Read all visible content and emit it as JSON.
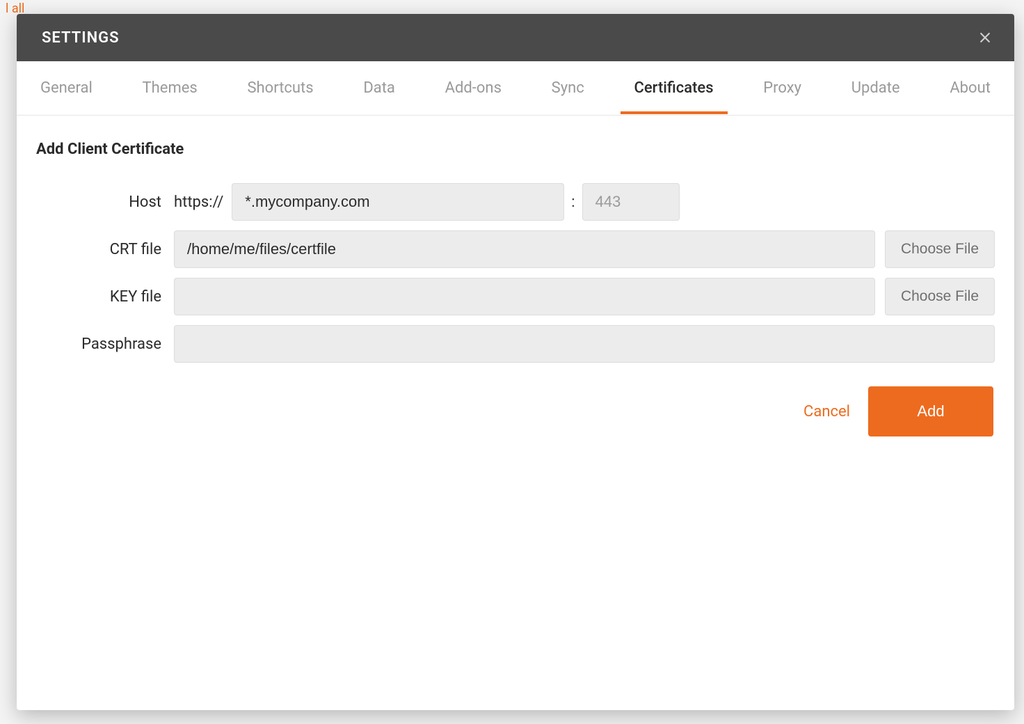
{
  "background": {
    "top_text": "l all"
  },
  "modal": {
    "title": "SETTINGS"
  },
  "tabs": {
    "items": [
      {
        "label": "General"
      },
      {
        "label": "Themes"
      },
      {
        "label": "Shortcuts"
      },
      {
        "label": "Data"
      },
      {
        "label": "Add-ons"
      },
      {
        "label": "Sync"
      },
      {
        "label": "Certificates"
      },
      {
        "label": "Proxy"
      },
      {
        "label": "Update"
      },
      {
        "label": "About"
      }
    ],
    "active_index": 6
  },
  "section": {
    "title": "Add Client Certificate",
    "host": {
      "label": "Host",
      "prefix": "https://",
      "value": "*.mycompany.com",
      "port_placeholder": "443",
      "port_value": ""
    },
    "crt": {
      "label": "CRT file",
      "value": "/home/me/files/certfile",
      "button": "Choose File"
    },
    "key": {
      "label": "KEY file",
      "value": "",
      "button": "Choose File"
    },
    "passphrase": {
      "label": "Passphrase",
      "value": ""
    },
    "actions": {
      "cancel": "Cancel",
      "add": "Add"
    }
  }
}
